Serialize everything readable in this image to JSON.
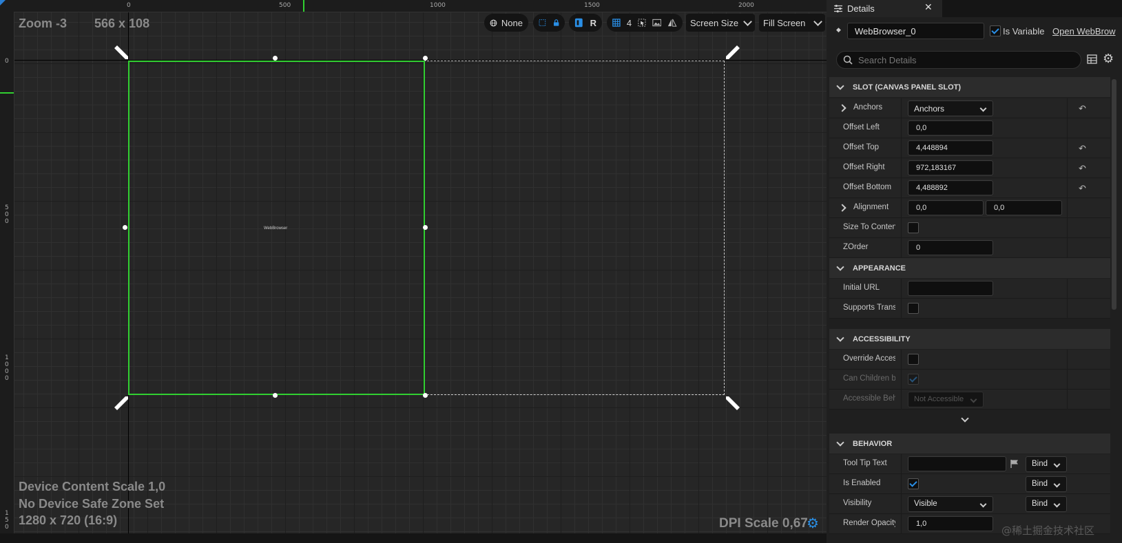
{
  "viewport": {
    "zoom": "Zoom -3",
    "size": "566 x 108",
    "ruler_top": [
      "0",
      "500",
      "1000",
      "1500",
      "2000"
    ],
    "ruler_left": [
      [
        "0"
      ],
      [
        "5",
        "0",
        "0"
      ],
      [
        "1",
        "0",
        "0",
        "0"
      ],
      [
        "1",
        "5",
        "0"
      ]
    ],
    "device_content_scale": "Device Content Scale 1,0",
    "safe_zone": "No Device Safe Zone Set",
    "resolution": "1280 x 720 (16:9)",
    "dpi_scale": "DPI Scale 0,67",
    "widget_label": "WebBrowser"
  },
  "toolbar": {
    "localization": "None",
    "respect_locks": "R",
    "grid_snap": "4",
    "screen_size": "Screen Size",
    "fill_screen": "Fill Screen"
  },
  "details": {
    "tab_title": "Details",
    "widget_name": "WebBrowser_0",
    "is_variable_label": "Is Variable",
    "is_variable_checked": true,
    "open_link": "Open WebBrow",
    "search_placeholder": "Search Details",
    "categories": {
      "slot": "SLOT (CANVAS PANEL SLOT)",
      "appearance": "APPEARANCE",
      "accessibility": "ACCESSIBILITY",
      "behavior": "BEHAVIOR"
    },
    "slot": {
      "anchors_label": "Anchors",
      "anchors_value": "Anchors",
      "offset_left_label": "Offset Left",
      "offset_left": "0,0",
      "offset_top_label": "Offset Top",
      "offset_top": "4,448894",
      "offset_right_label": "Offset Right",
      "offset_right": "972,183167",
      "offset_bottom_label": "Offset Bottom",
      "offset_bottom": "4,488892",
      "alignment_label": "Alignment",
      "alignment_x": "0,0",
      "alignment_y": "0,0",
      "size_to_content_label": "Size To Content",
      "zorder_label": "ZOrder",
      "zorder": "0"
    },
    "appearance": {
      "initial_url_label": "Initial URL",
      "initial_url": "",
      "supports_transparency_label": "Supports Transp"
    },
    "accessibility": {
      "override_label": "Override Access",
      "can_children_label": "Can Children be A",
      "accessible_behavior_label": "Accessible Beha",
      "accessible_behavior_value": "Not Accessible"
    },
    "behavior": {
      "tooltip_label": "Tool Tip Text",
      "tooltip_value": "",
      "bind": "Bind",
      "is_enabled_label": "Is Enabled",
      "visibility_label": "Visibility",
      "visibility_value": "Visible",
      "render_opacity_label": "Render Opacity",
      "render_opacity": "1,0"
    }
  },
  "watermark": "@稀土掘金技术社区",
  "colors": {
    "selection": "#31d031",
    "accent": "#2a8fe6",
    "panel_bg": "#1f1f1f",
    "viewport_bg": "#242424"
  }
}
